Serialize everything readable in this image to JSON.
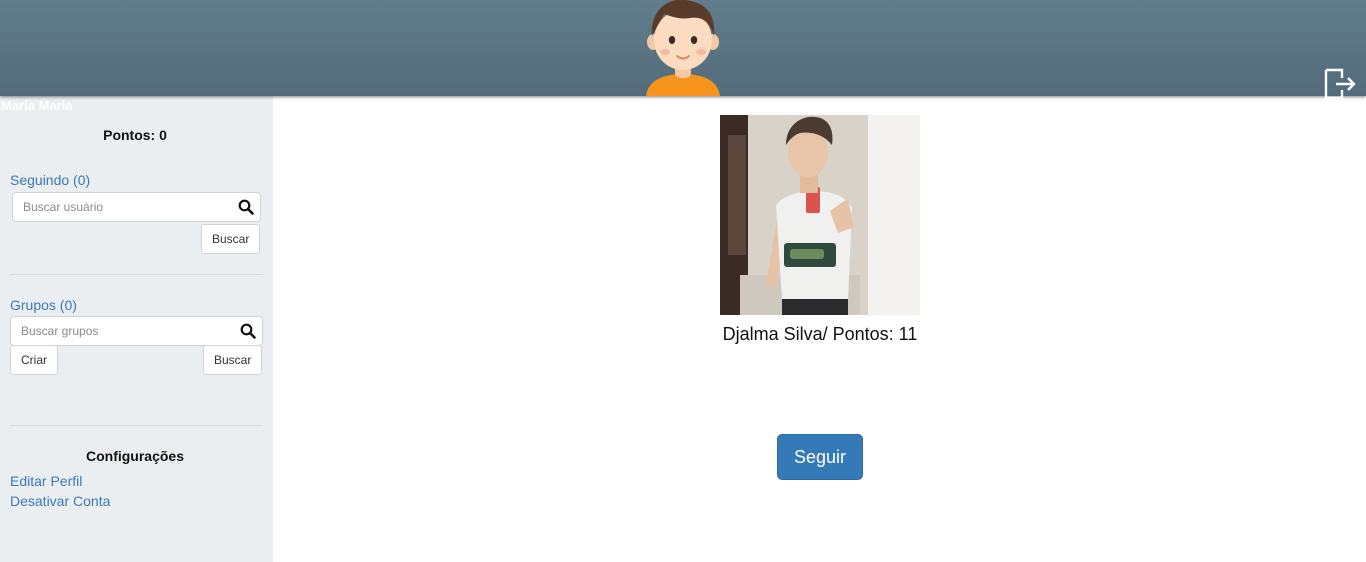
{
  "header": {
    "avatar_icon": "boy-avatar-icon",
    "logout_icon": "logout-icon",
    "colors": {
      "background": "#5a7484"
    }
  },
  "sidebar": {
    "user_name": "Maria Maria",
    "points_label": "Pontos: 0",
    "following": {
      "link_label": "Seguindo (0)",
      "search_placeholder": "Buscar usuário",
      "search_button": "Buscar"
    },
    "groups": {
      "link_label": "Grupos (0)",
      "search_placeholder": "Buscar grupos",
      "create_button": "Criar",
      "search_button": "Buscar"
    },
    "settings": {
      "title": "Configurações",
      "items": [
        {
          "label": "Editar Perfil"
        },
        {
          "label": "Desativar Conta"
        }
      ]
    }
  },
  "profile": {
    "caption": "Djalma Silva/ Pontos: 11",
    "follow_button": "Seguir"
  },
  "colors": {
    "accent": "#337ab7",
    "link": "#3b79b4",
    "sidebar_bg": "#ebeef1"
  }
}
